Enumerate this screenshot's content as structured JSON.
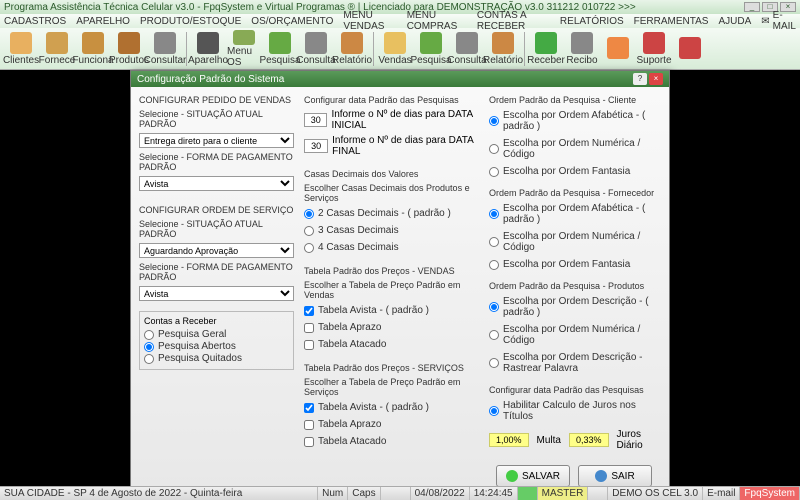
{
  "window": {
    "title": "Programa Assistência Técnica Celular v3.0 - FpqSystem e Virtual Programas ® | Licenciado para  DEMONSTRAÇÃO v3.0 311212 010722 >>>"
  },
  "menu": {
    "items": [
      "CADASTROS",
      "APARELHO",
      "PRODUTO/ESTOQUE",
      "OS/ORÇAMENTO",
      "MENU VENDAS",
      "MENU COMPRAS",
      "CONTAS A RECEBER",
      "RELATÓRIOS",
      "FERRAMENTAS",
      "AJUDA"
    ],
    "email": "E-MAIL"
  },
  "toolbar": [
    {
      "label": "Clientes",
      "color": "#e8b060"
    },
    {
      "label": "Fornece",
      "color": "#d0a050"
    },
    {
      "label": "Funciona",
      "color": "#c89040"
    },
    {
      "label": "Produtos",
      "color": "#b07030"
    },
    {
      "label": "Consultar",
      "color": "#888"
    },
    {
      "sep": true
    },
    {
      "label": "Aparelho",
      "color": "#555"
    },
    {
      "label": "Menu OS",
      "color": "#8a5"
    },
    {
      "label": "Pesquisa",
      "color": "#6a4"
    },
    {
      "label": "Consulta",
      "color": "#888"
    },
    {
      "label": "Relatório",
      "color": "#c84"
    },
    {
      "sep": true
    },
    {
      "label": "Vendas",
      "color": "#e8c060"
    },
    {
      "label": "Pesquisa",
      "color": "#6a4"
    },
    {
      "label": "Consulta",
      "color": "#888"
    },
    {
      "label": "Relatório",
      "color": "#c84"
    },
    {
      "sep": true
    },
    {
      "label": "Receber",
      "color": "#4a4"
    },
    {
      "label": "Recibo",
      "color": "#888"
    },
    {
      "label": "",
      "color": "#e84"
    },
    {
      "label": "Suporte",
      "color": "#c44"
    },
    {
      "label": "",
      "color": "#c44"
    }
  ],
  "dialog": {
    "title": "Configuração Padrão do Sistema",
    "col1": {
      "g1_title": "CONFIGURAR PEDIDO DE VENDAS",
      "g1_l1": "Selecione - SITUAÇÃO ATUAL PADRÃO",
      "g1_s1": "Entrega direto para o cliente",
      "g1_l2": "Selecione - FORMA DE PAGAMENTO PADRÃO",
      "g1_s2": "Avista",
      "g2_title": "CONFIGURAR ORDEM DE SERVIÇO",
      "g2_l1": "Selecione - SITUAÇÃO ATUAL PADRÃO",
      "g2_s1": "Aguardando Aprovação",
      "g2_l2": "Selecione - FORMA DE PAGAMENTO PADRÃO",
      "g2_s2": "Avista",
      "fs_title": "Contas a Receber",
      "r1": "Pesquisa Geral",
      "r2": "Pesquisa Abertos",
      "r3": "Pesquisa Quitados"
    },
    "col2": {
      "g1_title": "Configurar data Padrão das Pesquisas",
      "n1": "30",
      "n1_lbl": "Informe o Nº de dias para DATA INICIAL",
      "n2": "30",
      "n2_lbl": "Informe o Nº de dias para DATA FINAL",
      "g2_title": "Casas Decimais dos Valores",
      "g2_sub": "Escolher Casas Decimais dos Produtos e Serviços",
      "r1": "2 Casas Decimais - ( padrão )",
      "r2": "3 Casas Decimais",
      "r3": "4 Casas Decimais",
      "g3_title": "Tabela Padrão dos Preços - VENDAS",
      "g3_sub": "Escolher a Tabela de Preço Padrão em Vendas",
      "c1": "Tabela Avista - ( padrão )",
      "c2": "Tabela Aprazo",
      "c3": "Tabela Atacado",
      "g4_title": "Tabela Padrão dos Preços - SERVIÇOS",
      "g4_sub": "Escolher a Tabela de Preço Padrão em Serviços",
      "c4": "Tabela Avista - ( padrão )",
      "c5": "Tabela Aprazo",
      "c6": "Tabela Atacado"
    },
    "col3": {
      "g1_title": "Ordem Padrão da Pesquisa - Cliente",
      "g1_r1": "Escolha por Ordem Afabética - ( padrão )",
      "g1_r2": "Escolha por Ordem Numérica / Código",
      "g1_r3": "Escolha por Ordem Fantasia",
      "g2_title": "Ordem Padrão da Pesquisa - Fornecedor",
      "g2_r1": "Escolha por Ordem Afabética - ( padrão )",
      "g2_r2": "Escolha por Ordem Numérica / Código",
      "g2_r3": "Escolha por Ordem Fantasia",
      "g3_title": "Ordem Padrão da Pesquisa - Produtos",
      "g3_r1": "Escolha por Ordem Descrição - ( padrão )",
      "g3_r2": "Escolha por Ordem Numérica / Código",
      "g3_r3": "Escolha por Ordem Descrição - Rastrear Palavra",
      "g4_title": "Configurar data Padrão das Pesquisas",
      "g4_r1": "Habilitar Calculo de Juros nos Títulos",
      "multa_val": "1,00%",
      "multa_lbl": "Multa",
      "juros_val": "0,33%",
      "juros_lbl": "Juros Diário",
      "btn_save": "SALVAR",
      "btn_exit": "SAIR"
    }
  },
  "status": {
    "left": "SUA CIDADE - SP  4 de Agosto de 2022 - Quinta-feira",
    "num": "Num",
    "caps": "Caps",
    "date": "04/08/2022",
    "time": "14:24:45",
    "master": "MASTER",
    "demo": "DEMO OS CEL 3.0",
    "email": "E-mail",
    "fpq": "FpqSystem"
  }
}
